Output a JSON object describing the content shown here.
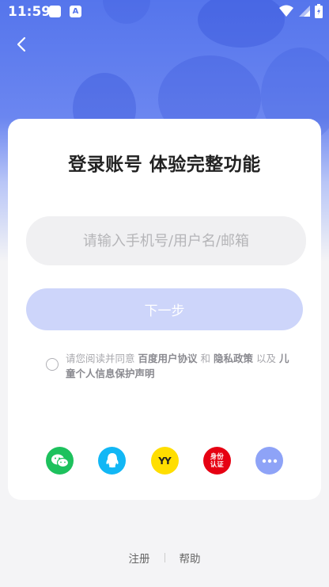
{
  "status_bar": {
    "time": "11:59",
    "app_icon_letter": "A"
  },
  "header": {
    "back_icon": "chevron-left-icon"
  },
  "login": {
    "title": "登录账号 体验完整功能",
    "account_placeholder": "请输入手机号/用户名/邮箱",
    "next_label": "下一步"
  },
  "agreement": {
    "prefix": "请您阅读并同意",
    "user_agreement": "百度用户协议",
    "and": "和",
    "privacy_policy": "隐私政策",
    "and2": "以及",
    "children_statement": "儿童个人信息保护声明"
  },
  "social": {
    "wechat": {
      "icon": "wechat-icon",
      "color": "#1dc15d"
    },
    "qq": {
      "icon": "qq-icon",
      "color": "#12b7f5"
    },
    "yy": {
      "icon": "yy-icon",
      "color": "#ffde00",
      "label": "YY"
    },
    "id": {
      "icon": "id-verify-icon",
      "color": "#e60012",
      "label_line1": "身份",
      "label_line2": "认证"
    },
    "more": {
      "icon": "more-icon",
      "color": "#8ea3f7"
    }
  },
  "footer": {
    "register": "注册",
    "help": "帮助"
  },
  "colors": {
    "accent": "#5575ec",
    "button_disabled": "#cdd5fa"
  }
}
